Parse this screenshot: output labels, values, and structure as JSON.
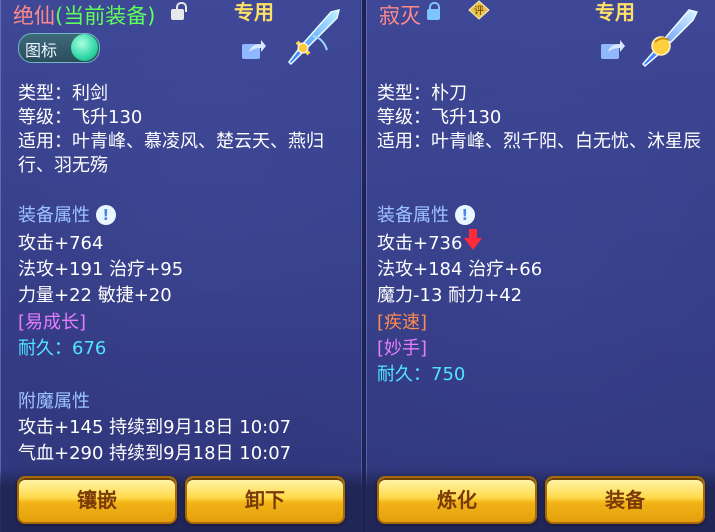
{
  "left": {
    "title_name": "绝仙",
    "title_equip": "(当前装备)",
    "zhuanyong": "专用",
    "toggle_label": "图标",
    "type": "类型：利剑",
    "level": "等级：飞升130",
    "usable": "适用：叶青峰、慕凌风、楚云天、燕归行、羽无殇",
    "attr_header": "装备属性",
    "info_glyph": "!",
    "stats": [
      "攻击+764",
      "法攻+191 治疗+95",
      "力量+22 敏捷+20"
    ],
    "special": "[易成长]",
    "durability": "耐久：676",
    "enchant_header": "附魔属性",
    "enchant": [
      "攻击+145 持续到9月18日 10:07",
      "气血+290 持续到9月18日 10:07"
    ],
    "buttons": [
      "镶嵌",
      "卸下"
    ]
  },
  "right": {
    "title_name": "寂灭",
    "badge_glyph": "评",
    "zhuanyong": "专用",
    "type": "类型：朴刀",
    "level": "等级：飞升130",
    "usable": "适用：叶青峰、烈千阳、白无忧、沐星辰",
    "attr_header": "装备属性",
    "info_glyph": "!",
    "stat_attack": "攻击+736",
    "stats": [
      "法攻+184 治疗+66",
      "魔力-13 耐力+42"
    ],
    "special1": "[疾速]",
    "special2": "[妙手]",
    "durability": "耐久：750",
    "buttons": [
      "炼化",
      "装备"
    ]
  },
  "colors": {
    "title_red": "#ff8a8a",
    "equip_green": "#5cff5c",
    "section_blue": "#9ec4ff",
    "durability_cyan": "#52e4ff",
    "special_orange": "#ff8a52",
    "special_purple": "#e67cff",
    "button_gold": "#ffd94a"
  }
}
